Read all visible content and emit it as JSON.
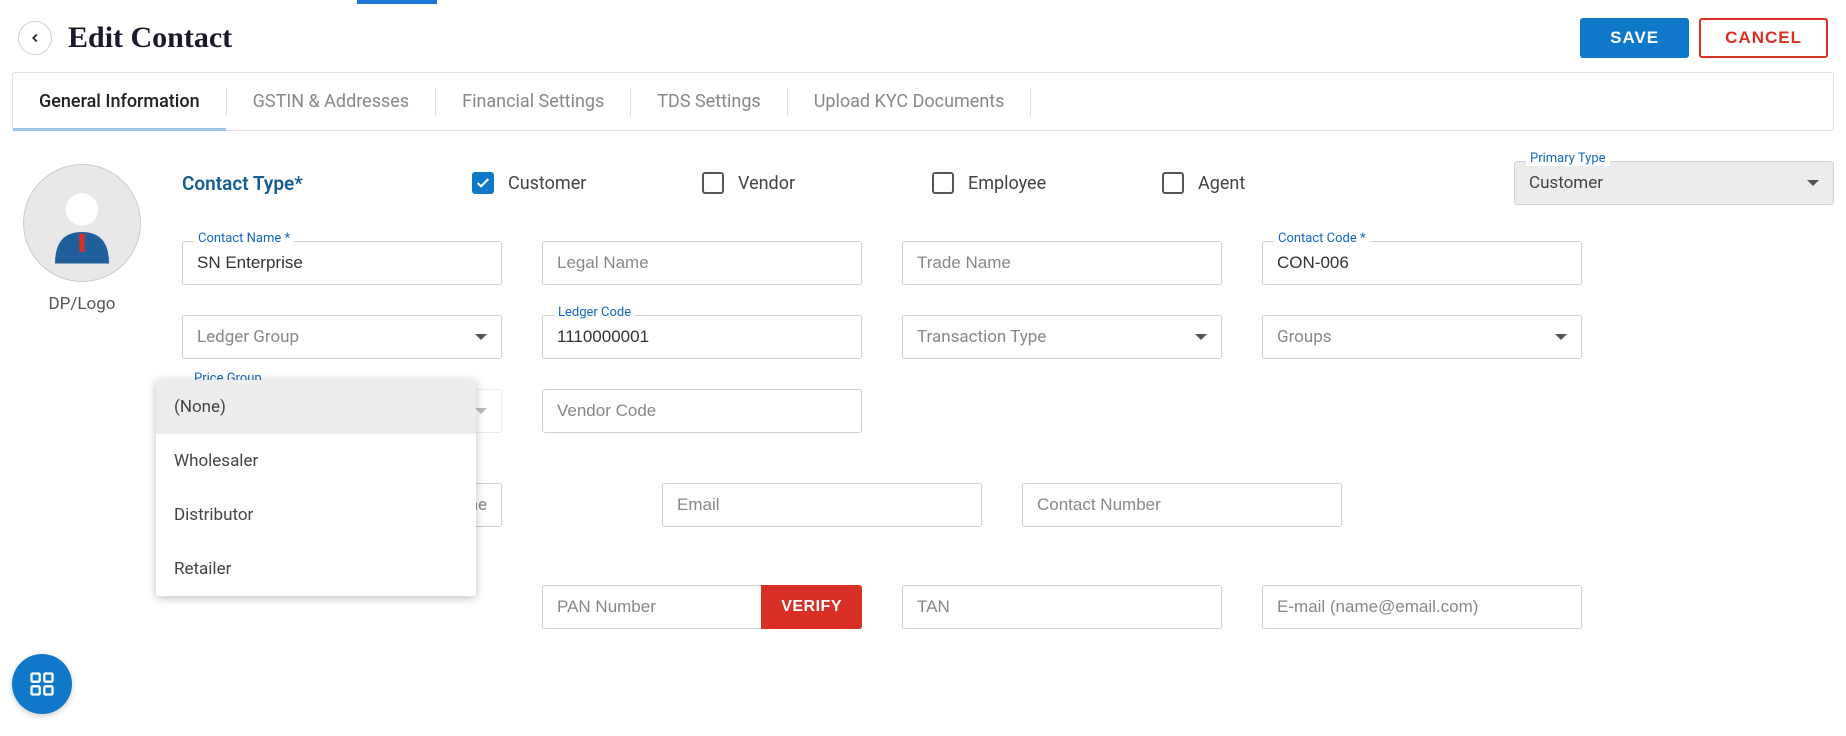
{
  "header": {
    "title": "Edit Contact",
    "save_label": "SAVE",
    "cancel_label": "CANCEL"
  },
  "tabs": [
    "General Information",
    "GSTIN & Addresses",
    "Financial Settings",
    "TDS Settings",
    "Upload KYC Documents"
  ],
  "avatar_label": "DP/Logo",
  "contact_type": {
    "label": "Contact Type*",
    "options": [
      {
        "label": "Customer",
        "checked": true
      },
      {
        "label": "Vendor",
        "checked": false
      },
      {
        "label": "Employee",
        "checked": false
      },
      {
        "label": "Agent",
        "checked": false
      }
    ],
    "primary_label": "Primary Type",
    "primary_value": "Customer"
  },
  "fields": {
    "contact_name_label": "Contact Name *",
    "contact_name_value": "SN Enterprise",
    "legal_name_ph": "Legal Name",
    "trade_name_ph": "Trade Name",
    "contact_code_label": "Contact Code *",
    "contact_code_value": "CON-006",
    "ledger_group_ph": "Ledger Group",
    "ledger_code_label": "Ledger Code",
    "ledger_code_value": "1110000001",
    "transaction_type_ph": "Transaction Type",
    "groups_ph": "Groups",
    "price_group_label": "Price Group",
    "vendor_code_ph": "Vendor Code",
    "partial_name_ph": "me",
    "email_ph": "Email",
    "contact_number_ph": "Contact Number",
    "pan_ph": "PAN Number",
    "verify_label": "VERIFY",
    "tan_ph": "TAN",
    "email_full_ph": "E-mail (name@email.com)"
  },
  "dropdown": {
    "items": [
      "(None)",
      "Wholesaler",
      "Distributor",
      "Retailer"
    ]
  }
}
